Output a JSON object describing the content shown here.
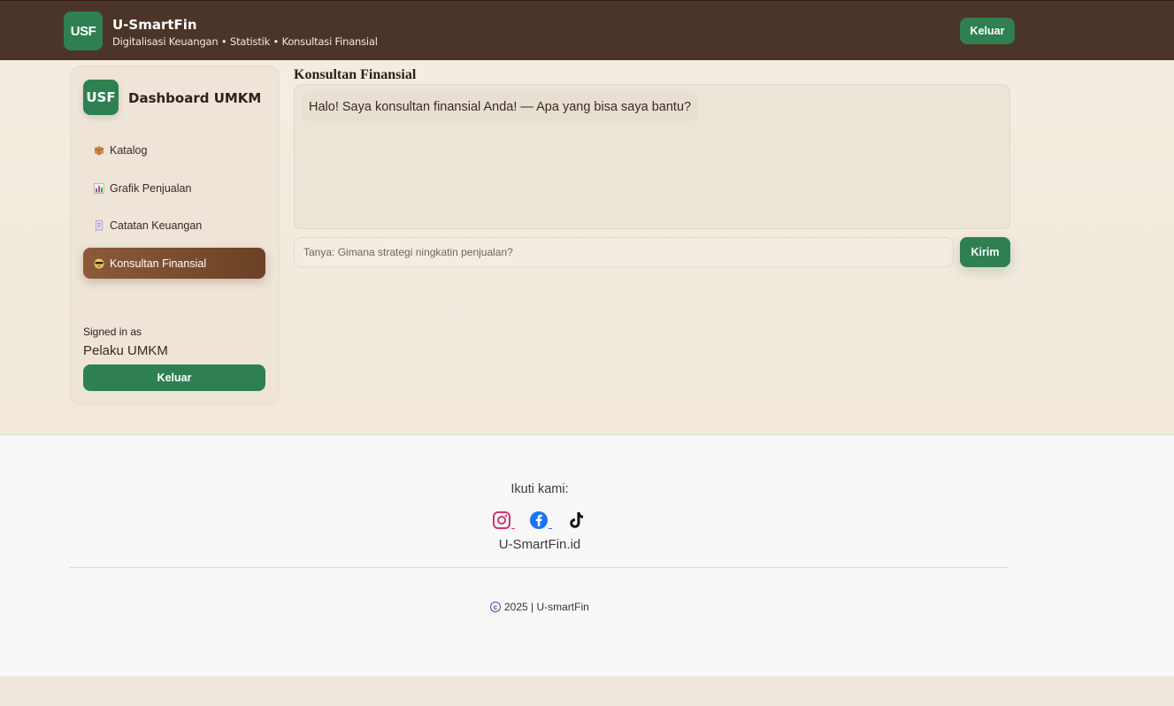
{
  "header": {
    "logo_text": "USF",
    "title": "U-SmartFin",
    "subtitle": "Digitalisasi Keuangan • Statistik • Konsultasi Finansial",
    "logout_label": "Keluar"
  },
  "sidebar": {
    "logo_text": "USF",
    "title": "Dashboard UMKM",
    "items": [
      {
        "label": "Katalog",
        "icon": "package-icon",
        "active": false
      },
      {
        "label": "Grafik Penjualan",
        "icon": "bar-chart-icon",
        "active": false
      },
      {
        "label": "Catatan Keuangan",
        "icon": "receipt-icon",
        "active": false
      },
      {
        "label": "Konsultan Finansial",
        "icon": "consultant-icon",
        "active": true
      }
    ],
    "signed_in_label": "Signed in as",
    "signed_in_user": "Pelaku UMKM",
    "logout_label": "Keluar"
  },
  "chat": {
    "title": "Konsultan Finansial",
    "messages": [
      {
        "from": "bot",
        "text": "Halo! Saya konsultan finansial Anda! — Apa yang bisa saya bantu?"
      }
    ],
    "input_placeholder": "Tanya: Gimana strategi ningkatin penjualan?",
    "input_value": "",
    "send_label": "Kirim"
  },
  "footer": {
    "follow_label": "Ikuti kami:",
    "socials": [
      "instagram-icon",
      "facebook-icon",
      "tiktok-icon"
    ],
    "handle": "U-SmartFin.id",
    "copyright": "2025 | U-smartFin"
  },
  "colors": {
    "header_bg": "#4b3428",
    "accent_green": "#2e8052",
    "active_nav": "#7a4c2f",
    "page_bg": "#f3ebdf"
  }
}
